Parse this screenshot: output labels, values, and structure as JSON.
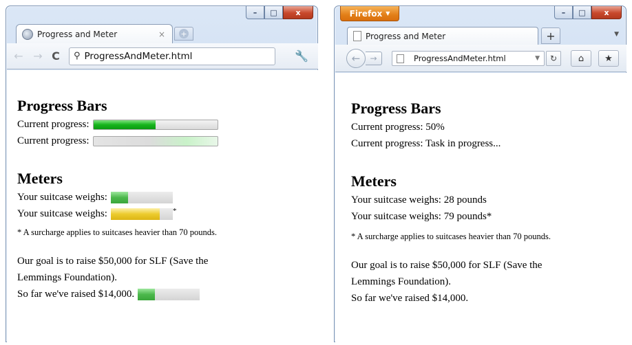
{
  "chrome": {
    "tab_title": "Progress and Meter",
    "tab_close": "×",
    "newtab": "+",
    "address": "ProgressAndMeter.html",
    "window_buttons": [
      "–",
      "□",
      "x"
    ]
  },
  "firefox": {
    "app_button": "Firefox",
    "tab_title": "Progress and Meter",
    "newtab": "+",
    "address": "ProgressAndMeter.html",
    "window_buttons": [
      "–",
      "□",
      "x"
    ]
  },
  "page": {
    "progress_heading": "Progress Bars",
    "progress_label": "Current progress:",
    "progress_value": 0.5,
    "progress_fallback_text": "Current progress: 50%",
    "progress_indeterminate_fallback_text": "Current progress: Task in progress...",
    "meters_heading": "Meters",
    "meter_label": "Your suitcase weighs:",
    "meter1_value": 28,
    "meter2_value": 79,
    "meter_max": 100,
    "meter1_fallback_text": "Your suitcase weighs: 28 pounds",
    "meter2_fallback_text": "Your suitcase weighs: 79 pounds*",
    "asterisk": "*",
    "surcharge_note": "* A surcharge applies to suitcases heavier than 70 pounds.",
    "goal_line1": "Our goal is to raise $50,000 for SLF (Save the",
    "goal_line2": "Lemmings Foundation).",
    "raised_text": "So far we've raised $14,000.",
    "raised_value": 14000,
    "goal_value": 50000
  },
  "colors": {
    "progress_fill": "#16b51c",
    "meter_ok": "#4cb84c",
    "meter_warn": "#eccb2e",
    "firefox_orange": "#e27f18"
  }
}
